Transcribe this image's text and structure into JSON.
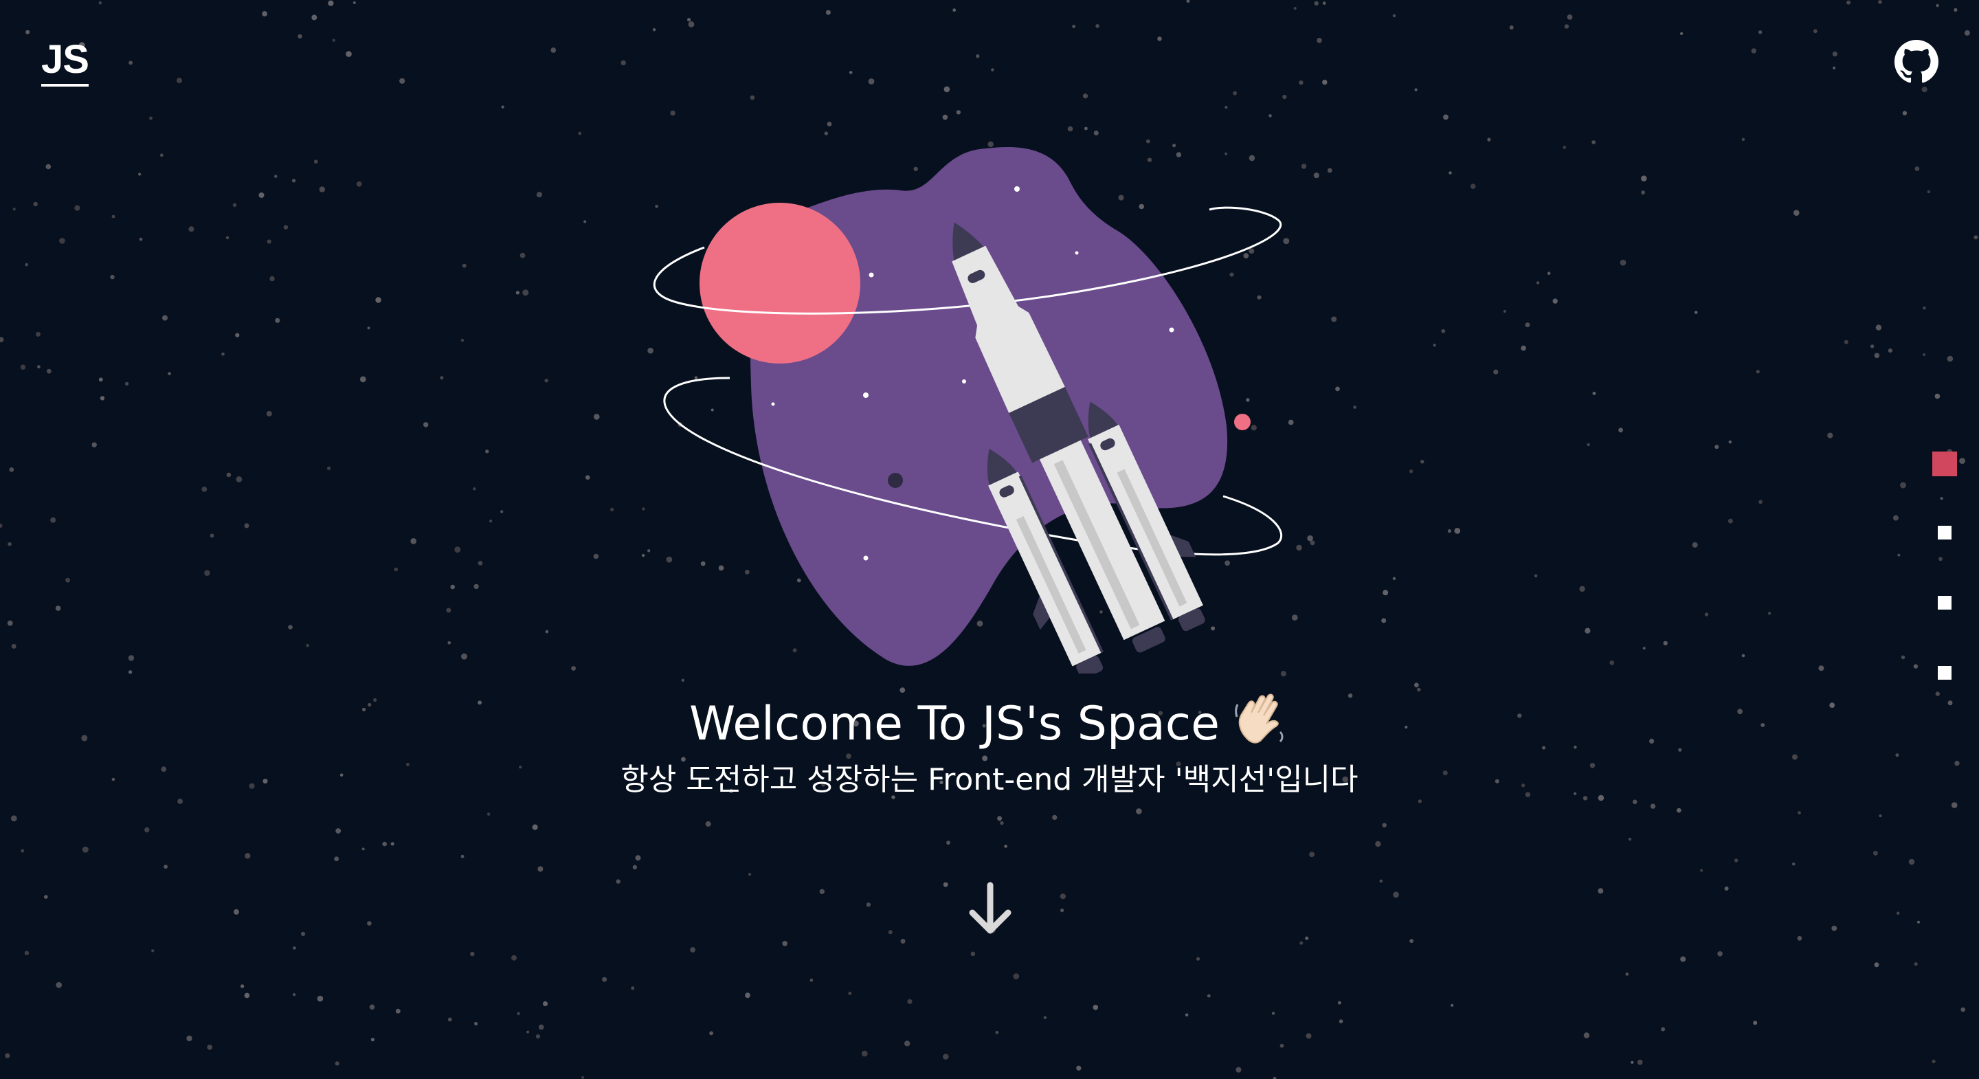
{
  "header": {
    "logo_text": "JS",
    "github_icon": "github-icon"
  },
  "hero": {
    "title": "Welcome To JS's Space",
    "title_emoji": "waving-hand-icon",
    "subtitle": "항상 도전하고 성장하는 Front-end 개발자 '백지선'입니다"
  },
  "scroll": {
    "icon": "arrow-down-icon"
  },
  "section_nav": {
    "count": 4,
    "active_index": 0
  },
  "colors": {
    "background": "#07101e",
    "accent": "#d0475e",
    "planet": "#ef7085",
    "blob": "#6a4b8c",
    "rocket_body": "#e6e6e6",
    "rocket_dark": "#3d3a54"
  }
}
